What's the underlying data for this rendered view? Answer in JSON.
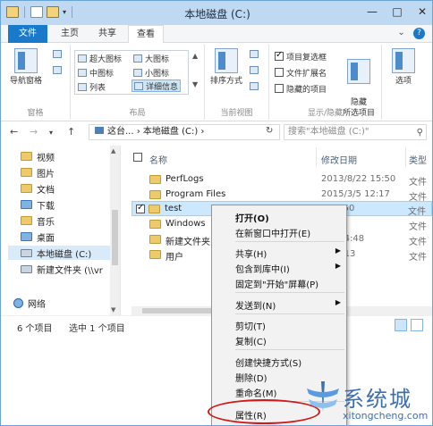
{
  "window": {
    "title": "本地磁盘 (C:)"
  },
  "window_buttons": {
    "minimize": "—",
    "maximize": "□",
    "close": "✕"
  },
  "tabs": {
    "file": "文件",
    "home": "主页",
    "share": "共享",
    "view": "查看"
  },
  "tab_right": {
    "caret": "⌄",
    "help": "?"
  },
  "ribbon": {
    "panes": {
      "nav_pane": "导航窗格",
      "group_label": "窗格"
    },
    "layout": {
      "items": [
        "超大图标",
        "大图标",
        "中图标",
        "小图标",
        "列表",
        "详细信息"
      ],
      "group_label": "布局"
    },
    "current_view": {
      "sort": "排序方式",
      "group_label": "当前视图"
    },
    "show_hide": {
      "checkboxes": [
        {
          "label": "项目复选框",
          "checked": true
        },
        {
          "label": "文件扩展名",
          "checked": false
        },
        {
          "label": "隐藏的项目",
          "checked": false
        }
      ],
      "hide_selected": "隐藏\n所选项目",
      "options": "选项",
      "group_label": "显示/隐藏"
    }
  },
  "address": {
    "path": "这台... › 本地磁盘 (C:) ›",
    "search_placeholder": "搜索\"本地磁盘 (C:)\""
  },
  "nav_pane": {
    "items": [
      {
        "label": "视频",
        "icon": "video-folder-icon"
      },
      {
        "label": "图片",
        "icon": "pictures-folder-icon"
      },
      {
        "label": "文档",
        "icon": "documents-folder-icon"
      },
      {
        "label": "下载",
        "icon": "downloads-folder-icon"
      },
      {
        "label": "音乐",
        "icon": "music-folder-icon"
      },
      {
        "label": "桌面",
        "icon": "desktop-folder-icon"
      },
      {
        "label": "本地磁盘 (C:)",
        "icon": "drive-icon",
        "selected": true
      },
      {
        "label": "新建文件夹 (\\\\vr",
        "icon": "network-drive-icon"
      },
      {
        "label": "网络",
        "icon": "network-icon"
      }
    ]
  },
  "file_list": {
    "columns": {
      "name": "名称",
      "date": "修改日期",
      "type": "类型"
    },
    "rows": [
      {
        "name": "PerfLogs",
        "date": "2013/8/22 15:50",
        "type": "文件"
      },
      {
        "name": "Program Files",
        "date": "2015/3/5 12:17",
        "type": "文件"
      },
      {
        "name": "test",
        "date": "8 14:50",
        "type": "文件",
        "selected": true
      },
      {
        "name": "Windows",
        "date": "",
        "type": "文件"
      },
      {
        "name": "新建文件夹",
        "date": "/27 14:48",
        "type": "文件"
      },
      {
        "name": "用户",
        "date": "5 12:13",
        "type": "文件"
      }
    ]
  },
  "status": {
    "count": "6 个项目",
    "selected": "选中 1 个项目"
  },
  "context_menu": {
    "items": [
      {
        "label": "打开(O)",
        "bold": true,
        "submenu": false
      },
      {
        "label": "在新窗口中打开(E)",
        "submenu": false
      },
      {
        "label": "共享(H)",
        "submenu": true
      },
      {
        "label": "包含到库中(I)",
        "submenu": true
      },
      {
        "label": "固定到\"开始\"屏幕(P)",
        "submenu": false
      },
      {
        "label": "发送到(N)",
        "submenu": true
      },
      {
        "label": "剪切(T)",
        "submenu": false
      },
      {
        "label": "复制(C)",
        "submenu": false
      },
      {
        "label": "创建快捷方式(S)",
        "submenu": false
      },
      {
        "label": "删除(D)",
        "submenu": false
      },
      {
        "label": "重命名(M)",
        "submenu": false
      },
      {
        "label": "属性(R)",
        "submenu": false,
        "highlighted_ring": true
      }
    ]
  },
  "watermark": {
    "text": "系统城",
    "url": "xitongcheng.com"
  },
  "colors": {
    "accent": "#1979ca",
    "selection": "#cce8ff",
    "ring": "#d01818",
    "watermark": "#3b6fb1"
  }
}
